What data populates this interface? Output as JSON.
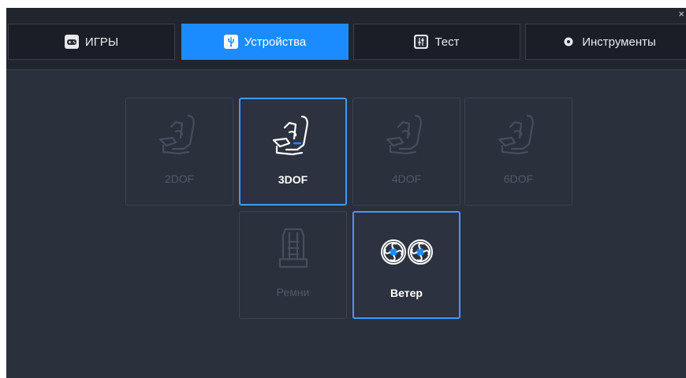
{
  "window": {
    "close_label": "×"
  },
  "tabs": [
    {
      "label": "ИГРЫ",
      "icon": "gamepad-icon",
      "active": false
    },
    {
      "label": "Устройства",
      "icon": "usb-icon",
      "active": true
    },
    {
      "label": "Тест",
      "icon": "sliders-icon",
      "active": false
    },
    {
      "label": "Инструменты",
      "icon": "gear-icon",
      "active": false
    }
  ],
  "devices": [
    {
      "label": "2DOF",
      "icon": "motion-seat-icon",
      "selected": false
    },
    {
      "label": "3DOF",
      "icon": "motion-seat-icon",
      "selected": true
    },
    {
      "label": "4DOF",
      "icon": "motion-seat-icon",
      "selected": false
    },
    {
      "label": "6DOF",
      "icon": "motion-seat-icon",
      "selected": false
    },
    {
      "label": "Ремни",
      "icon": "seat-belt-icon",
      "selected": false
    },
    {
      "label": "Ветер",
      "icon": "fans-icon",
      "selected": true
    }
  ],
  "colors": {
    "accent": "#1a8cff",
    "background": "#2b303d",
    "tab_bar": "#21252e",
    "selected_border": "#3d9bff",
    "disabled_text": "#525868"
  }
}
